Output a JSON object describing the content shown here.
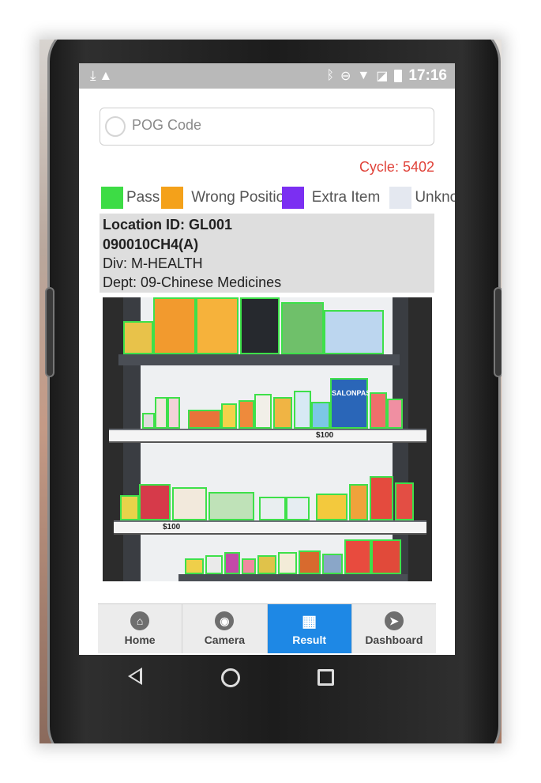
{
  "status_bar": {
    "time": "17:16",
    "left_icons": [
      "download-icon",
      "warning-icon"
    ],
    "right_icons": [
      "bluetooth-icon",
      "do-not-disturb-icon",
      "wifi-icon",
      "no-sim-icon",
      "battery-icon"
    ]
  },
  "search": {
    "placeholder": "POG Code",
    "value": ""
  },
  "cycle_label": "Cycle: 5402",
  "legend": [
    {
      "label": "Pass",
      "color": "#3ddc45"
    },
    {
      "label": "Wrong Position",
      "color": "#f4a11a"
    },
    {
      "label": "Extra Item",
      "color": "#7b2ff2"
    },
    {
      "label": "Unknown",
      "color": "#e4e8f0"
    }
  ],
  "location": {
    "location_id": "Location ID: GL001",
    "code": "090010CH4(A)",
    "div": "Div: M-HEALTH",
    "dept": "Dept: 09-Chinese Medicines"
  },
  "shelf_image": {
    "price_labels": [
      "$100",
      "$100"
    ],
    "product_labels": [
      "SALONPAS"
    ]
  },
  "nav": [
    {
      "label": "Home",
      "icon": "home-icon",
      "active": false
    },
    {
      "label": "Camera",
      "icon": "camera-icon",
      "active": false
    },
    {
      "label": "Result",
      "icon": "grid-icon",
      "active": true
    },
    {
      "label": "Dashboard",
      "icon": "navigation-icon",
      "active": false
    }
  ]
}
